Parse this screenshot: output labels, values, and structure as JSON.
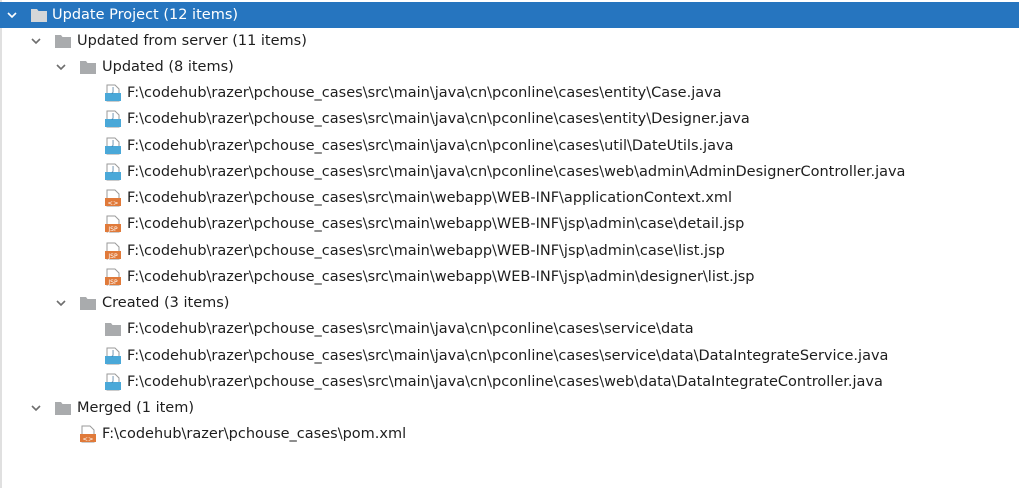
{
  "root": {
    "label": "Update Project (12 items)",
    "groups": [
      {
        "label": "Updated from server (11 items)",
        "subgroups": [
          {
            "label": "Updated (8 items)",
            "files": [
              {
                "path": "F:\\codehub\\razer\\pchouse_cases\\src\\main\\java\\cn\\pconline\\cases\\entity\\Case.java",
                "icon": "java-file-icon"
              },
              {
                "path": "F:\\codehub\\razer\\pchouse_cases\\src\\main\\java\\cn\\pconline\\cases\\entity\\Designer.java",
                "icon": "java-file-icon"
              },
              {
                "path": "F:\\codehub\\razer\\pchouse_cases\\src\\main\\java\\cn\\pconline\\cases\\util\\DateUtils.java",
                "icon": "java-file-icon"
              },
              {
                "path": "F:\\codehub\\razer\\pchouse_cases\\src\\main\\java\\cn\\pconline\\cases\\web\\admin\\AdminDesignerController.java",
                "icon": "java-file-icon"
              },
              {
                "path": "F:\\codehub\\razer\\pchouse_cases\\src\\main\\webapp\\WEB-INF\\applicationContext.xml",
                "icon": "xml-file-icon"
              },
              {
                "path": "F:\\codehub\\razer\\pchouse_cases\\src\\main\\webapp\\WEB-INF\\jsp\\admin\\case\\detail.jsp",
                "icon": "jsp-file-icon"
              },
              {
                "path": "F:\\codehub\\razer\\pchouse_cases\\src\\main\\webapp\\WEB-INF\\jsp\\admin\\case\\list.jsp",
                "icon": "jsp-file-icon"
              },
              {
                "path": "F:\\codehub\\razer\\pchouse_cases\\src\\main\\webapp\\WEB-INF\\jsp\\admin\\designer\\list.jsp",
                "icon": "jsp-file-icon"
              }
            ]
          },
          {
            "label": "Created (3 items)",
            "files": [
              {
                "path": "F:\\codehub\\razer\\pchouse_cases\\src\\main\\java\\cn\\pconline\\cases\\service\\data",
                "icon": "folder-icon"
              },
              {
                "path": "F:\\codehub\\razer\\pchouse_cases\\src\\main\\java\\cn\\pconline\\cases\\service\\data\\DataIntegrateService.java",
                "icon": "java-file-icon"
              },
              {
                "path": "F:\\codehub\\razer\\pchouse_cases\\src\\main\\java\\cn\\pconline\\cases\\web\\data\\DataIntegrateController.java",
                "icon": "java-file-icon"
              }
            ]
          }
        ]
      },
      {
        "label": "Merged (1 item)",
        "files": [
          {
            "path": "F:\\codehub\\razer\\pchouse_cases\\pom.xml",
            "icon": "xml-file-icon"
          }
        ]
      }
    ]
  },
  "colors": {
    "selection": "#2675bf",
    "folder": "#a9abad",
    "java_blue": "#4aa8d8",
    "orange": "#e07a3a"
  }
}
